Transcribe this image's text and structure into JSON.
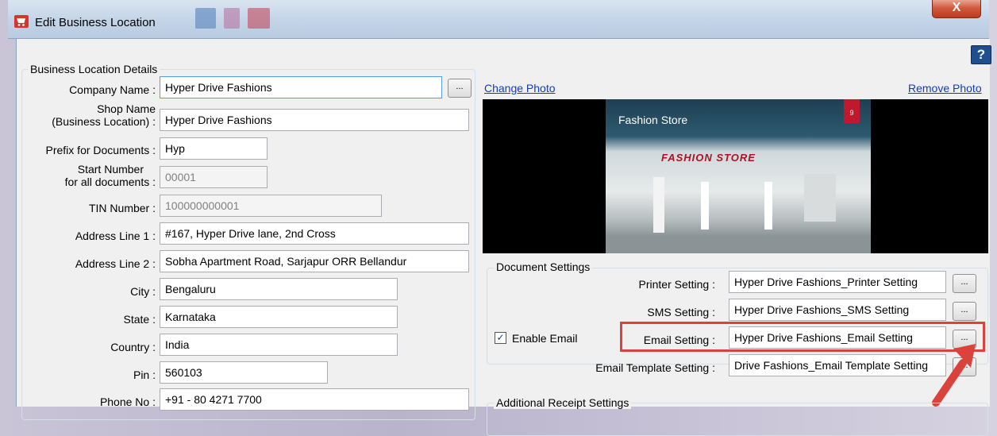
{
  "window": {
    "title": "Edit Business Location",
    "close_label": "X",
    "help_label": "?"
  },
  "details": {
    "legend": "Business Location Details",
    "browse_label": "...",
    "company_name": {
      "label": "Company Name :",
      "value": "Hyper Drive Fashions"
    },
    "shop_name": {
      "label_line1": "Shop Name",
      "label_line2": "(Business Location) :",
      "value": "Hyper Drive Fashions"
    },
    "prefix": {
      "label": "Prefix for Documents :",
      "value": "Hyp"
    },
    "start_number": {
      "label_line1": "Start Number",
      "label_line2": "for all documents :",
      "value": "00001"
    },
    "tin": {
      "label": "TIN Number :",
      "value": "100000000001"
    },
    "address1": {
      "label": "Address Line 1 :",
      "value": "#167, Hyper Drive lane, 2nd Cross"
    },
    "address2": {
      "label": "Address Line 2 :",
      "value": "Sobha Apartment Road, Sarjapur ORR Bellandur"
    },
    "city": {
      "label": "City :",
      "value": "Bengaluru"
    },
    "state": {
      "label": "State :",
      "value": "Karnataka"
    },
    "country": {
      "label": "Country :",
      "value": "India"
    },
    "pin": {
      "label": "Pin :",
      "value": "560103"
    },
    "phone": {
      "label": "Phone No :",
      "value": "+91 - 80 4271 7700"
    }
  },
  "photo": {
    "change_label": "Change Photo",
    "remove_label": "Remove Photo",
    "store_caption": "Fashion Store",
    "store_tag": "9",
    "store_sign": "FASHION STORE"
  },
  "document_settings": {
    "legend": "Document Settings",
    "browse_label": "...",
    "printer": {
      "label": "Printer Setting :",
      "value": "Hyper Drive Fashions_Printer Setting"
    },
    "sms": {
      "label": "SMS Setting :",
      "value": "Hyper Drive Fashions_SMS Setting"
    },
    "enable_email": {
      "label": "Enable Email",
      "checked": true,
      "check_glyph": "✓"
    },
    "email": {
      "label": "Email Setting :",
      "value": "Hyper Drive Fashions_Email Setting"
    },
    "email_template": {
      "label": "Email Template Setting :",
      "value": "Drive Fashions_Email Template Setting"
    }
  },
  "additional_receipt": {
    "legend": "Additional Receipt Settings"
  },
  "colors": {
    "highlight": "#d9433b",
    "arrow": "#d9433b",
    "link": "#0f3cc4"
  }
}
